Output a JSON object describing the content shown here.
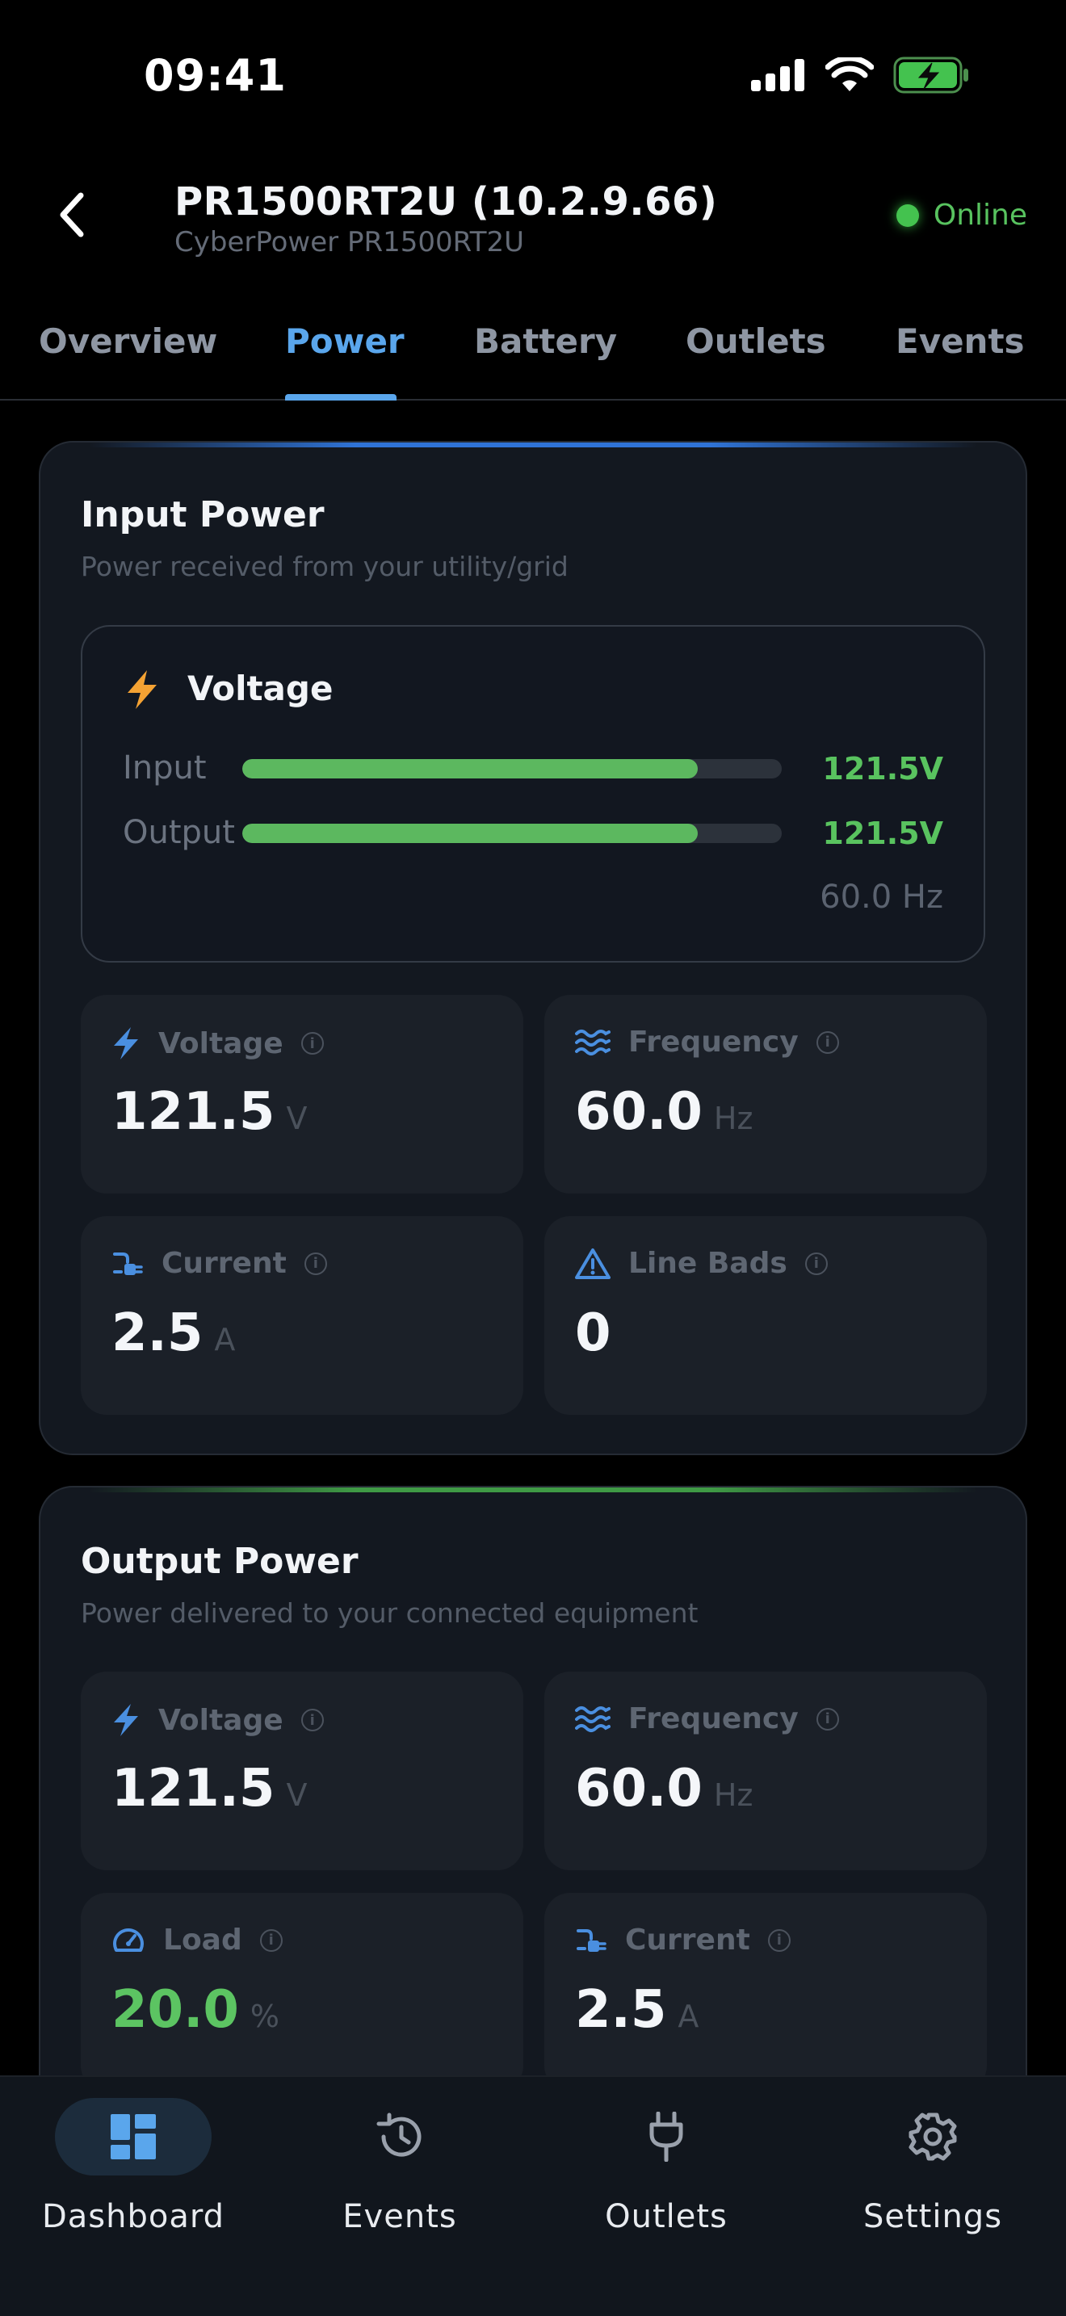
{
  "status_bar": {
    "time": "09:41"
  },
  "header": {
    "title": "PR1500RT2U (10.2.9.66)",
    "subtitle": "CyberPower PR1500RT2U",
    "status": "Online"
  },
  "tabs": [
    {
      "label": "Overview"
    },
    {
      "label": "Power"
    },
    {
      "label": "Battery"
    },
    {
      "label": "Outlets"
    },
    {
      "label": "Events"
    }
  ],
  "active_tab": "Power",
  "input_power": {
    "title": "Input Power",
    "description": "Power received from your utility/grid",
    "voltage_box": {
      "title": "Voltage",
      "rows": [
        {
          "label": "Input",
          "value": "121.5V",
          "fill": 0.845
        },
        {
          "label": "Output",
          "value": "121.5V",
          "fill": 0.845
        }
      ],
      "frequency": "60.0 Hz"
    },
    "metrics": [
      {
        "label": "Voltage",
        "value": "121.5",
        "unit": "V",
        "icon": "bolt-icon"
      },
      {
        "label": "Frequency",
        "value": "60.0",
        "unit": "Hz",
        "icon": "waves-icon"
      },
      {
        "label": "Current",
        "value": "2.5",
        "unit": "A",
        "icon": "plug-current-icon"
      },
      {
        "label": "Line Bads",
        "value": "0",
        "unit": "",
        "icon": "warning-icon"
      }
    ]
  },
  "output_power": {
    "title": "Output Power",
    "description": "Power delivered to your connected equipment",
    "metrics": [
      {
        "label": "Voltage",
        "value": "121.5",
        "unit": "V",
        "icon": "bolt-icon"
      },
      {
        "label": "Frequency",
        "value": "60.0",
        "unit": "Hz",
        "icon": "waves-icon"
      },
      {
        "label": "Load",
        "value": "20.0",
        "unit": "%",
        "icon": "gauge-icon"
      },
      {
        "label": "Current",
        "value": "2.5",
        "unit": "A",
        "icon": "plug-current-icon"
      }
    ]
  },
  "bottom_nav": [
    {
      "label": "Dashboard",
      "icon": "dashboard-icon"
    },
    {
      "label": "Events",
      "icon": "history-icon"
    },
    {
      "label": "Outlets",
      "icon": "plug-icon"
    },
    {
      "label": "Settings",
      "icon": "gear-icon"
    }
  ],
  "active_nav": "Dashboard",
  "colors": {
    "accent": "#5aa6ec",
    "success": "#5cc462",
    "warning": "#f4a233",
    "card": "#131820",
    "tile": "#1b2028"
  }
}
